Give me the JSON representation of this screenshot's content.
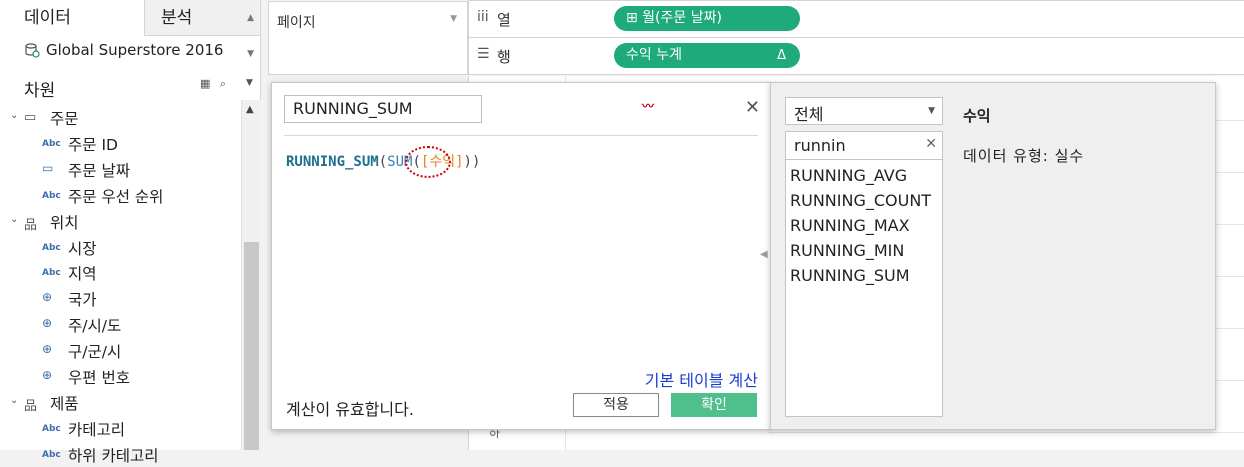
{
  "tabs": {
    "data": "데이터",
    "analysis": "분석"
  },
  "datasource": "Global Superstore 2016",
  "dimensions_header": "차원",
  "tree": [
    {
      "label": "주문",
      "type": "folder"
    },
    {
      "label": "주문 ID",
      "type": "abc"
    },
    {
      "label": "주문 날짜",
      "type": "date"
    },
    {
      "label": "주문 우선 순위",
      "type": "abc"
    },
    {
      "label": "위치",
      "type": "hierarchy"
    },
    {
      "label": "시장",
      "type": "abc"
    },
    {
      "label": "지역",
      "type": "abc"
    },
    {
      "label": "국가",
      "type": "geo"
    },
    {
      "label": "주/시/도",
      "type": "geo"
    },
    {
      "label": "구/군/시",
      "type": "geo"
    },
    {
      "label": "우편 번호",
      "type": "geo"
    },
    {
      "label": "제품",
      "type": "hierarchy"
    },
    {
      "label": "카테고리",
      "type": "abc"
    },
    {
      "label": "하위 카테고리",
      "type": "abc"
    }
  ],
  "icons": {
    "abc": "Abc",
    "date": "▭",
    "geo": "⊕",
    "folder": "▭",
    "hierarchy": "品"
  },
  "pages_label": "페이지",
  "shelves": {
    "columns_label": "열",
    "rows_label": "행",
    "columns_pill": "⊞ 월(주문 날짜)",
    "rows_pill": "수익 누계",
    "rows_pill_flag": "Δ"
  },
  "sheet_axis_text": "하",
  "calc": {
    "name": "RUNNING_SUM",
    "formula_fn": "RUNNING_SUM",
    "formula_inner_fn": "SUM",
    "formula_field": "[수익]",
    "table_calc_link": "기본 테이블 계산",
    "status": "계산이 유효합니다.",
    "apply_label": "적용",
    "ok_label": "확인"
  },
  "functions": {
    "category": "전체",
    "search": "runnin",
    "items": [
      "RUNNING_AVG",
      "RUNNING_COUNT",
      "RUNNING_MAX",
      "RUNNING_MIN",
      "RUNNING_SUM"
    ],
    "detail_title": "수익",
    "detail_desc": "데이터 유형: 실수"
  },
  "colors": {
    "pill": "#1eaa7b",
    "ok_button": "#4fbf8c",
    "link": "#1b3cd4",
    "annotation": "#cc0000"
  }
}
